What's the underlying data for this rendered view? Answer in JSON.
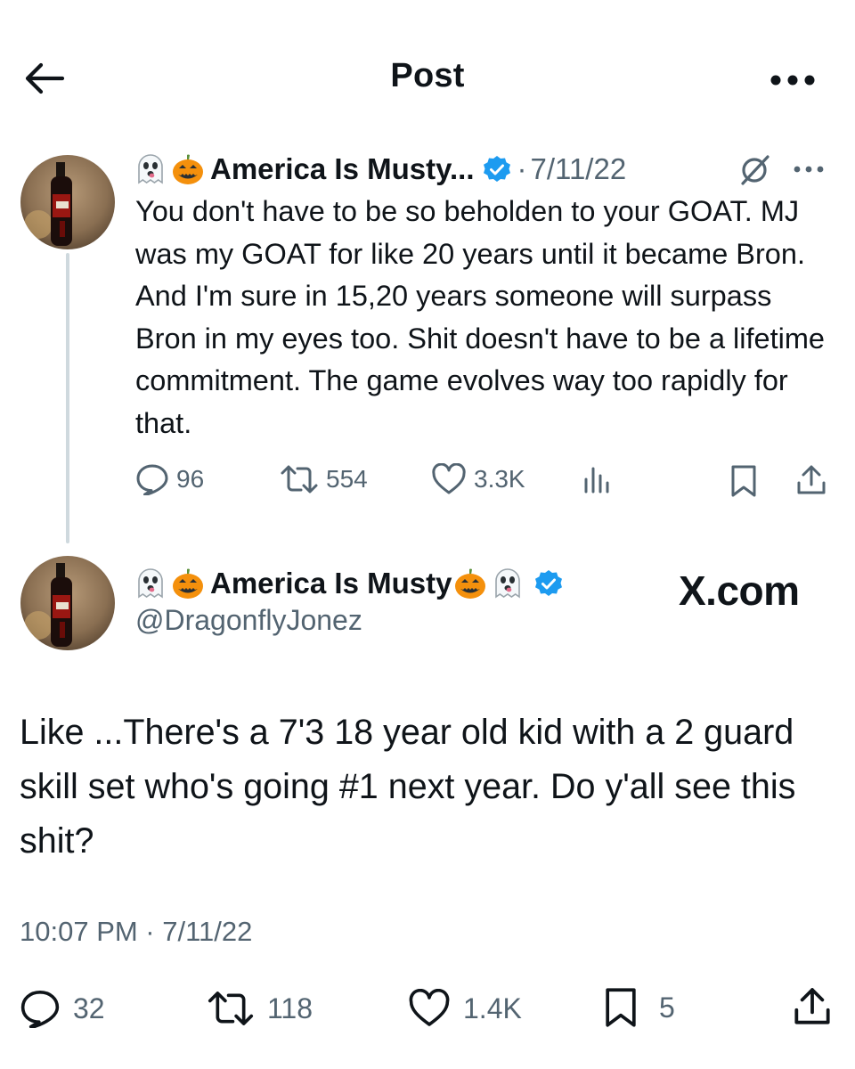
{
  "header": {
    "title": "Post",
    "back_icon": "arrow-left-icon",
    "more_icon": "more-horizontal-icon"
  },
  "parent_tweet": {
    "display_name": "America Is Musty...",
    "name_emojis": [
      "ghost",
      "jack-o-lantern"
    ],
    "dot": "·",
    "date": "7/11/22",
    "verified_color": "#1d9bf0",
    "text": "You don't have to be so beholden to your GOAT. MJ was my GOAT for like 20 years until it became Bron. And I'm sure in 15,20 years someone will surpass Bron in my eyes too. Shit doesn't have to be a lifetime commitment. The game evolves way too rapidly for that.",
    "actions": {
      "replies": "96",
      "reposts": "554",
      "likes": "3.3K"
    }
  },
  "main_tweet": {
    "display_name": "America Is Musty",
    "name_emojis_pre": [
      "ghost",
      "jack-o-lantern"
    ],
    "name_emojis_post": [
      "jack-o-lantern",
      "ghost"
    ],
    "handle": "@DragonflyJonez",
    "watermark": "X.com",
    "text": "Like ...There's a 7'3 18 year old kid with a 2 guard skill set who's going #1 next year. Do y'all see this shit?",
    "timestamp": "10:07 PM · 7/11/22",
    "actions": {
      "replies": "32",
      "reposts": "118",
      "likes": "1.4K",
      "bookmarks": "5"
    }
  },
  "colors": {
    "text": "#0f1419",
    "secondary": "#536471",
    "thread_line": "#cfd9de",
    "verified": "#1d9bf0"
  }
}
